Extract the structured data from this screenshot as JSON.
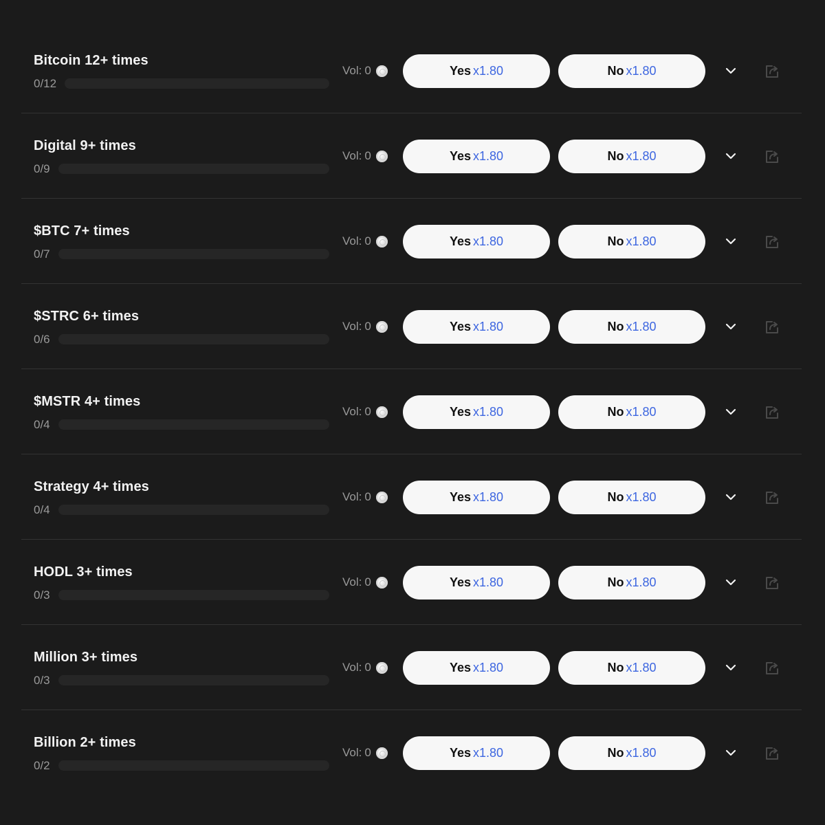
{
  "markets": [
    {
      "title": "Bitcoin 12+ times",
      "count": "0/12",
      "progress": 0,
      "vol_label": "Vol:",
      "vol": "0",
      "yes_label": "Yes",
      "yes_odds": "x1.80",
      "no_label": "No",
      "no_odds": "x1.80"
    },
    {
      "title": "Digital 9+ times",
      "count": "0/9",
      "progress": 0,
      "vol_label": "Vol:",
      "vol": "0",
      "yes_label": "Yes",
      "yes_odds": "x1.80",
      "no_label": "No",
      "no_odds": "x1.80"
    },
    {
      "title": "$BTC 7+ times",
      "count": "0/7",
      "progress": 0,
      "vol_label": "Vol:",
      "vol": "0",
      "yes_label": "Yes",
      "yes_odds": "x1.80",
      "no_label": "No",
      "no_odds": "x1.80"
    },
    {
      "title": "$STRC 6+ times",
      "count": "0/6",
      "progress": 0,
      "vol_label": "Vol:",
      "vol": "0",
      "yes_label": "Yes",
      "yes_odds": "x1.80",
      "no_label": "No",
      "no_odds": "x1.80"
    },
    {
      "title": "$MSTR 4+ times",
      "count": "0/4",
      "progress": 0,
      "vol_label": "Vol:",
      "vol": "0",
      "yes_label": "Yes",
      "yes_odds": "x1.80",
      "no_label": "No",
      "no_odds": "x1.80"
    },
    {
      "title": "Strategy 4+ times",
      "count": "0/4",
      "progress": 0,
      "vol_label": "Vol:",
      "vol": "0",
      "yes_label": "Yes",
      "yes_odds": "x1.80",
      "no_label": "No",
      "no_odds": "x1.80"
    },
    {
      "title": "HODL 3+ times",
      "count": "0/3",
      "progress": 0,
      "vol_label": "Vol:",
      "vol": "0",
      "yes_label": "Yes",
      "yes_odds": "x1.80",
      "no_label": "No",
      "no_odds": "x1.80"
    },
    {
      "title": "Million 3+ times",
      "count": "0/3",
      "progress": 0,
      "vol_label": "Vol:",
      "vol": "0",
      "yes_label": "Yes",
      "yes_odds": "x1.80",
      "no_label": "No",
      "no_odds": "x1.80"
    },
    {
      "title": "Billion 2+ times",
      "count": "0/2",
      "progress": 0,
      "vol_label": "Vol:",
      "vol": "0",
      "yes_label": "Yes",
      "yes_odds": "x1.80",
      "no_label": "No",
      "no_odds": "x1.80"
    }
  ],
  "icons": {
    "coin": "coin-icon",
    "expand": "chevron-down-icon",
    "share": "share-icon"
  },
  "colors": {
    "background": "#1b1b1b",
    "odds": "#3d66e0",
    "button_bg": "#f7f7f7",
    "track": "#262626"
  }
}
